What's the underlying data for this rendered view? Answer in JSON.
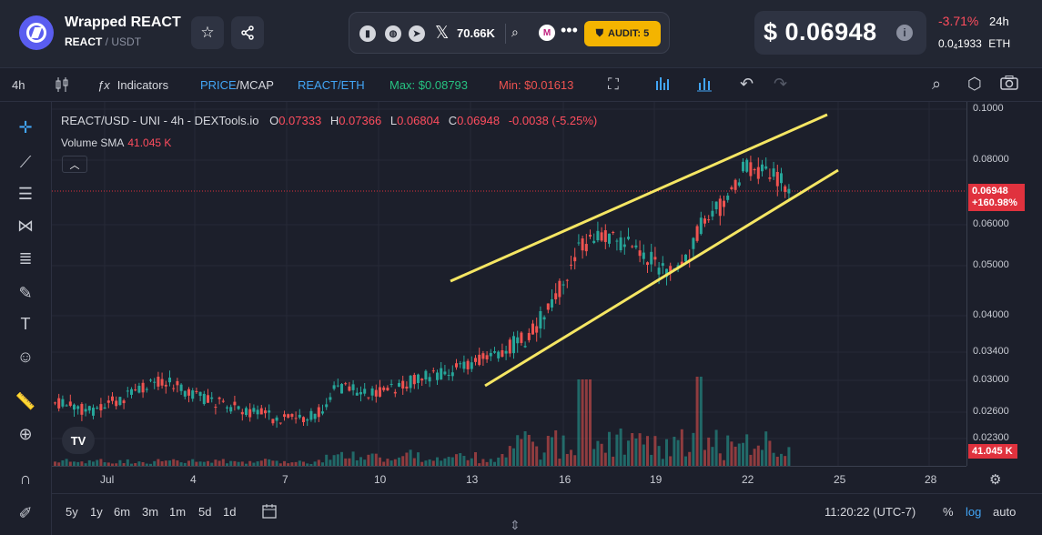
{
  "header": {
    "token_name": "Wrapped REACT",
    "pair_base": "REACT",
    "pair_sep": " / ",
    "pair_quote": "USDT",
    "social_count": "70.66K",
    "audit_label": "AUDIT: 5",
    "price": "$ 0.06948",
    "change": "-3.71%",
    "change_period": "24h",
    "eth_price_prefix": "0.0",
    "eth_price_sub": "4",
    "eth_price_rest": "1933",
    "eth_unit": "ETH"
  },
  "toolbar": {
    "interval": "4h",
    "indicators": "Indicators",
    "price_mcap_a": "PRICE",
    "price_mcap_b": "/MCAP",
    "pair_a": "REACT",
    "pair_b": "/ETH",
    "max": "Max: $0.08793",
    "min": "Min: $0.01613"
  },
  "legend": {
    "symbol": "REACT/USD - UNI - 4h - DEXTools.io",
    "o_label": "O",
    "o": "0.07333",
    "h_label": "H",
    "h": "0.07366",
    "l_label": "L",
    "l": "0.06804",
    "c_label": "C",
    "c": "0.06948",
    "chg": "-0.0038 (-5.25%)",
    "volume_label": "Volume SMA",
    "volume_value": "41.045 K"
  },
  "y_axis": [
    "0.1000",
    "0.08000",
    "0.06000",
    "0.05000",
    "0.04000",
    "0.03400",
    "0.03000",
    "0.02600",
    "0.02300"
  ],
  "x_axis": [
    "Jul",
    "4",
    "7",
    "10",
    "13",
    "16",
    "19",
    "22",
    "25",
    "28"
  ],
  "price_tag": {
    "price": "0.06948",
    "pct": "+160.98%"
  },
  "volume_tag": "41.045 K",
  "bottom": {
    "ranges": [
      "5y",
      "1y",
      "6m",
      "3m",
      "1m",
      "5d",
      "1d"
    ],
    "time": "11:20:22 (UTC-7)",
    "pct": "%",
    "log": "log",
    "auto": "auto"
  },
  "colors": {
    "up": "#26a69a",
    "down": "#ef5350",
    "trendline": "#f5e663",
    "accent_blue": "#2196f3"
  }
}
